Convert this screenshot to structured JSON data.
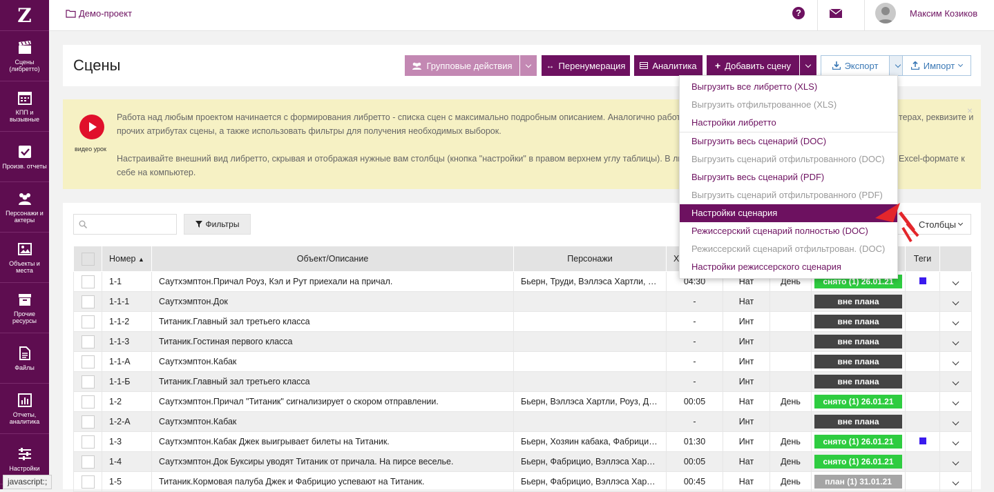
{
  "sidebar": {
    "logo": "Z",
    "items": [
      {
        "label": "Сцены (либретто)",
        "icon": "clapperboard-icon"
      },
      {
        "label": "КПП и вызывные",
        "icon": "calendar-icon"
      },
      {
        "label": "Произв. отчеты",
        "icon": "checkbox-icon"
      },
      {
        "label": "Персонажи и актеры",
        "icon": "users-icon"
      },
      {
        "label": "Объекты и места",
        "icon": "picture-icon"
      },
      {
        "label": "Прочие ресурсы",
        "icon": "archive-icon"
      },
      {
        "label": "Файлы",
        "icon": "file-icon"
      },
      {
        "label": "Отчеты, аналитика",
        "icon": "bar-chart-icon"
      },
      {
        "label": "Настройки",
        "icon": "sliders-icon"
      }
    ]
  },
  "topbar": {
    "project": "Демо-проект",
    "user": "Максим Козиков",
    "help": "?"
  },
  "header": {
    "title": "Сцены",
    "group_actions": "Групповые действия",
    "renumber": "Перенумерация",
    "analytics": "Аналитика",
    "add_scene": "Добавить сцену",
    "export": "Экспорт",
    "import": "Импорт"
  },
  "notice": {
    "video_label": "видео урок",
    "p1a": "Работа над любым проектом начинается с формирования либретто - списка сцен с максимально подробным описанием. Аналогично работе в",
    "p1b": "терах, реквизите и",
    "p1c": "прочих атрибутах сцены, а также использовать фильтры для получения необходимых выборок.",
    "p2a": "Настраивайте внешний вид либретто, скрывая и отображая нужные вам столбцы (кнопка \"настройки\" в правом верхнем углу таблицы). В любо",
    "p2b": "Excel-формате к",
    "p2c": "себе на компьютер.",
    "close": "×"
  },
  "toolbar": {
    "filters": "Фильтры",
    "columns": "Столбцы"
  },
  "table": {
    "headers": {
      "number": "Номер",
      "object": "Объект/Описание",
      "characters": "Персонажи",
      "time": "Х",
      "tags": "Теги"
    },
    "rows": [
      {
        "num": "1-1",
        "desc": "Саутхэмптон.Причал Роуз, Кэл и Рут приехали на причал.",
        "chars": "Бьерн, Труди, Вэллэса Хартли, Роуз, Рут",
        "time": "04:30",
        "place": "Нат",
        "daytime": "День",
        "status": "снято (1) 26.01.21",
        "status_color": "#2ecc40",
        "tag": true
      },
      {
        "num": "1-1-1",
        "desc": "Саутхэмптон.Док",
        "chars": "",
        "time": "-",
        "place": "Нат",
        "daytime": "",
        "status": "вне плана",
        "status_color": "#444444",
        "tag": false
      },
      {
        "num": "1-1-2",
        "desc": "Титаник.Главный зал третьего класса",
        "chars": "",
        "time": "-",
        "place": "Инт",
        "daytime": "",
        "status": "вне плана",
        "status_color": "#444444",
        "tag": false
      },
      {
        "num": "1-1-3",
        "desc": "Титаник.Гостиная первого класса",
        "chars": "",
        "time": "-",
        "place": "Инт",
        "daytime": "",
        "status": "вне плана",
        "status_color": "#444444",
        "tag": false
      },
      {
        "num": "1-1-А",
        "desc": "Саутхэмптон.Кабак",
        "chars": "",
        "time": "-",
        "place": "Инт",
        "daytime": "",
        "status": "вне плана",
        "status_color": "#444444",
        "tag": false
      },
      {
        "num": "1-1-Б",
        "desc": "Титаник.Главный зал третьего класса",
        "chars": "",
        "time": "-",
        "place": "Инт",
        "daytime": "",
        "status": "вне плана",
        "status_color": "#444444",
        "tag": false
      },
      {
        "num": "1-2",
        "desc": "Саутхэмптон.Причал \"Титаник\" сигнализирует о скором отправлении.",
        "chars": "Бьерн, Вэллэса Хартли, Роуз, Джек",
        "time": "00:05",
        "place": "Нат",
        "daytime": "День",
        "status": "снято (1) 26.01.21",
        "status_color": "#2ecc40",
        "tag": false
      },
      {
        "num": "1-2-А",
        "desc": "Саутхэмптон.Кабак",
        "chars": "",
        "time": "-",
        "place": "Инт",
        "daytime": "",
        "status": "вне плана",
        "status_color": "#444444",
        "tag": false
      },
      {
        "num": "1-3",
        "desc": "Саутхэмптон.Кабак Джек выигрывает билеты на Титаник.",
        "chars": "Бьерн, Хозяин кабака, Фабрицио, Джек",
        "time": "01:30",
        "place": "Инт",
        "daytime": "День",
        "status": "снято (1) 26.01.21",
        "status_color": "#2ecc40",
        "tag": true
      },
      {
        "num": "1-4",
        "desc": "Саутхэмптон.Док Буксиры уводят Титаник от причала. На пирсе веселье.",
        "chars": "Бьерн, Фабрицио, Вэллэса Хартли",
        "time": "00:05",
        "place": "Нат",
        "daytime": "День",
        "status": "снято (1) 26.01.21",
        "status_color": "#2ecc40",
        "tag": false
      },
      {
        "num": "1-5",
        "desc": "Титаник.Кормовая палуба Джек и Фабрицио успевают на Титаник.",
        "chars": "Бьерн, Фабрицио, Вэллэса Хартли",
        "time": "00:45",
        "place": "Нат",
        "daytime": "День",
        "status": "план (1) 31.01.21",
        "status_color": "#a5a5a5",
        "tag": false
      }
    ]
  },
  "export_menu": [
    {
      "label": "Выгрузить все либретто (XLS)",
      "state": "normal",
      "sep_after": false
    },
    {
      "label": "Выгрузить отфильтрованное (XLS)",
      "state": "disabled",
      "sep_after": false
    },
    {
      "label": "Настройки либретто",
      "state": "normal",
      "sep_after": true
    },
    {
      "label": "Выгрузить весь сценарий (DOC)",
      "state": "normal",
      "sep_after": false
    },
    {
      "label": "Выгрузить сценарий отфильтрованного (DOC)",
      "state": "disabled",
      "sep_after": false
    },
    {
      "label": "Выгрузить весь сценарий (PDF)",
      "state": "normal",
      "sep_after": false
    },
    {
      "label": "Выгрузить сценарий отфильтрованного (PDF)",
      "state": "disabled",
      "sep_after": false
    },
    {
      "label": "Настройки сценария",
      "state": "active",
      "sep_after": false
    },
    {
      "label": "Режиссерский сценарий полностью (DOC)",
      "state": "normal",
      "sep_after": false
    },
    {
      "label": "Режиссерский сценарий отфильтрован. (DOC)",
      "state": "disabled",
      "sep_after": false
    },
    {
      "label": "Настройки режиссерского сценария",
      "state": "normal",
      "sep_after": false
    }
  ],
  "browser_status": "javascript:;",
  "colors": {
    "brand": "#6d1160",
    "sidebar": "#5e0d50",
    "pale": "#c388b3",
    "notice": "#f6f1c4",
    "cursor": "#e3262b"
  }
}
